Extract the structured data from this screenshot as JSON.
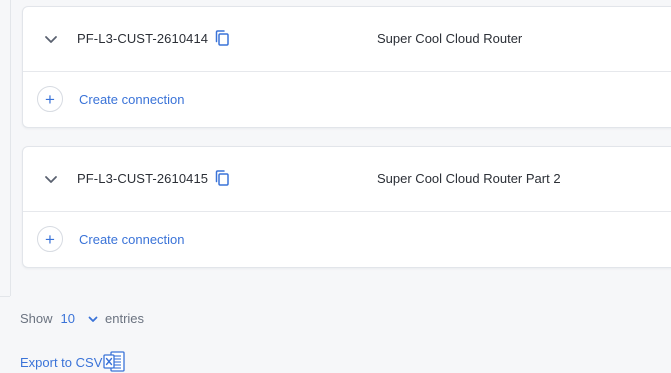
{
  "connections": [
    {
      "id": "PF-L3-CUST-2610414",
      "name": "Super Cool Cloud Router",
      "action_label": "Create connection"
    },
    {
      "id": "PF-L3-CUST-2610415",
      "name": "Super Cool Cloud Router Part 2",
      "action_label": "Create connection"
    }
  ],
  "pagination": {
    "show_label": "Show",
    "entries_value": "10",
    "entries_label": "entries"
  },
  "export": {
    "label": "Export to CSV",
    "icon": "excel-file-icon"
  },
  "colors": {
    "accent": "#3a73d8",
    "text": "#2b2f36",
    "muted": "#6b7380",
    "border": "#e2e5ea"
  }
}
